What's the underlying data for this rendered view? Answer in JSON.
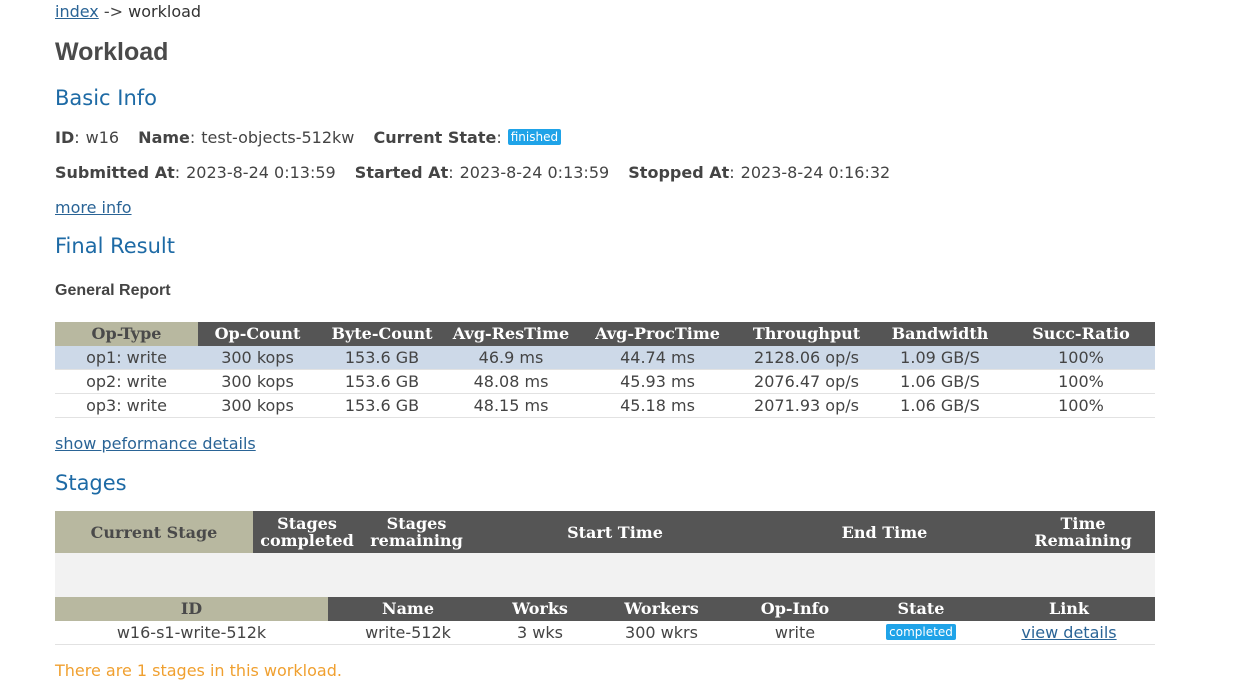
{
  "breadcrumb": {
    "home": "index",
    "separator": "->",
    "current": "workload"
  },
  "page_title": "Workload",
  "basic_info": {
    "heading": "Basic Info",
    "id_label": "ID",
    "id_value": "w16",
    "name_label": "Name",
    "name_value": "test-objects-512kw",
    "state_label": "Current State",
    "state_value": "finished",
    "submitted_label": "Submitted At",
    "submitted_value": "2023-8-24 0:13:59",
    "started_label": "Started At",
    "started_value": "2023-8-24 0:13:59",
    "stopped_label": "Stopped At",
    "stopped_value": "2023-8-24 0:16:32",
    "more_info": "more info"
  },
  "final_result": {
    "heading": "Final Result",
    "report_title": "General Report",
    "columns": [
      "Op-Type",
      "Op-Count",
      "Byte-Count",
      "Avg-ResTime",
      "Avg-ProcTime",
      "Throughput",
      "Bandwidth",
      "Succ-Ratio"
    ],
    "rows": [
      [
        "op1: write",
        "300 kops",
        "153.6 GB",
        "46.9 ms",
        "44.74 ms",
        "2128.06 op/s",
        "1.09 GB/S",
        "100%"
      ],
      [
        "op2: write",
        "300 kops",
        "153.6 GB",
        "48.08 ms",
        "45.93 ms",
        "2076.47 op/s",
        "1.06 GB/S",
        "100%"
      ],
      [
        "op3: write",
        "300 kops",
        "153.6 GB",
        "48.15 ms",
        "45.18 ms",
        "2071.93 op/s",
        "1.06 GB/S",
        "100%"
      ]
    ],
    "details_link": "show peformance details"
  },
  "stages": {
    "heading": "Stages",
    "summary_columns": {
      "current_stage": "Current Stage",
      "stages_completed_1": "Stages",
      "stages_completed_2": "completed",
      "stages_remaining_1": "Stages",
      "stages_remaining_2": "remaining",
      "start_time": "Start Time",
      "end_time": "End Time",
      "time_remaining_1": "Time",
      "time_remaining_2": "Remaining"
    },
    "list_columns": [
      "ID",
      "Name",
      "Works",
      "Workers",
      "Op-Info",
      "State",
      "Link"
    ],
    "list_rows": [
      {
        "id": "w16-s1-write-512k",
        "name": "write-512k",
        "works": "3 wks",
        "workers": "300 wkrs",
        "op_info": "write",
        "state": "completed",
        "link": "view details"
      }
    ],
    "footer": "There are 1 stages in this workload."
  },
  "colors": {
    "link": "#2a6496",
    "heading": "#1d6aa5",
    "badge": "#1fa3e8",
    "table_header": "#555555",
    "table_header_first": "#b8b8a0",
    "highlight_row": "#cdd9e8",
    "footer_note": "#f0a030"
  }
}
